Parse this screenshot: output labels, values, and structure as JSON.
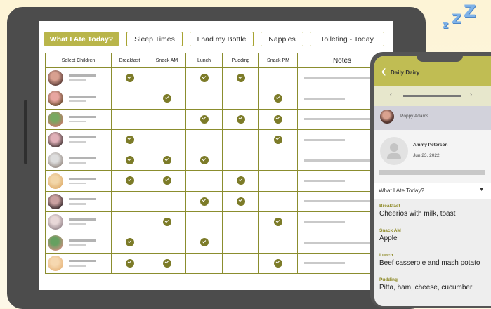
{
  "tabs": [
    {
      "label": "What I Ate Today?",
      "active": true
    },
    {
      "label": "Sleep Times",
      "active": false
    },
    {
      "label": "I had my Bottle",
      "active": false
    },
    {
      "label": "Nappies",
      "active": false
    },
    {
      "label": "Toileting - Today",
      "active": false
    }
  ],
  "table": {
    "columns": [
      "Select Children",
      "Breakfast",
      "Snack AM",
      "Lunch",
      "Pudding",
      "Snack PM",
      "Notes"
    ],
    "rows": [
      {
        "checks": [
          true,
          false,
          true,
          true,
          false
        ]
      },
      {
        "checks": [
          false,
          true,
          false,
          false,
          true
        ]
      },
      {
        "checks": [
          false,
          false,
          true,
          true,
          true
        ]
      },
      {
        "checks": [
          true,
          false,
          false,
          false,
          true
        ]
      },
      {
        "checks": [
          true,
          true,
          true,
          false,
          false
        ]
      },
      {
        "checks": [
          true,
          true,
          false,
          true,
          false
        ]
      },
      {
        "checks": [
          false,
          false,
          true,
          true,
          false
        ]
      },
      {
        "checks": [
          false,
          true,
          false,
          false,
          true
        ]
      },
      {
        "checks": [
          true,
          false,
          true,
          false,
          false
        ]
      },
      {
        "checks": [
          true,
          true,
          false,
          false,
          true
        ]
      }
    ]
  },
  "sleep_icon": {
    "text": "zZZ",
    "icon": "sleep-zzz-icon"
  },
  "phone": {
    "header_title": "Daily Dairy",
    "child_name": "Poppy Adams",
    "staff_name": "Ammy Peterson",
    "date": "Jun 23, 2022",
    "select_label": "What I Ate Today?",
    "meals": [
      {
        "label": "Breakfast",
        "value": "Cheerios with milk, toast"
      },
      {
        "label": "Snack AM",
        "value": "Apple"
      },
      {
        "label": "Lunch",
        "value": "Beef casserole and mash potato"
      },
      {
        "label": "Pudding",
        "value": "Pitta, ham, cheese, cucumber"
      }
    ]
  },
  "colors": {
    "accent": "#b9b54a",
    "check": "#7c7b28",
    "grid": "#8b8d2e",
    "tablet": "#4c4c4c"
  }
}
